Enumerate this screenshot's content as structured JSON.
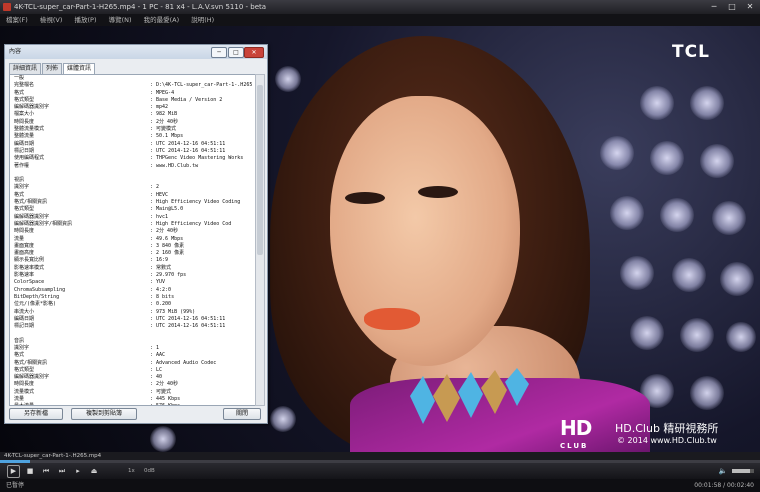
{
  "window": {
    "title": "4K-TCL-super_car-Part-1-H265.mp4 - 1 PC - 81 x4 - L.A.V.svn 5110 - beta",
    "min_label": "─",
    "max_label": "□",
    "close_label": "✕"
  },
  "menu": [
    "檔案(F)",
    "檢視(V)",
    "播放(P)",
    "導覽(N)",
    "我的最愛(A)",
    "說明(H)"
  ],
  "dialog": {
    "title": "內容",
    "min_label": "─",
    "max_label": "□",
    "close_label": "✕",
    "tabs": [
      "詳細資訊",
      "列佈",
      "媒體資訊"
    ],
    "active_tab": 2,
    "rows": [
      {
        "k": "一般",
        "v": ""
      },
      {
        "k": "完整檔名",
        "v": ": D:\\4K-TCL-super_car-Part-1-.H265"
      },
      {
        "k": "格式",
        "v": ": MPEG-4"
      },
      {
        "k": "格式類型",
        "v": ": Base Media / Version 2"
      },
      {
        "k": "編解碼器識別字",
        "v": ": mp42"
      },
      {
        "k": "檔案大小",
        "v": ": 982 MiB"
      },
      {
        "k": "時間長度",
        "v": ": 2分 40秒"
      },
      {
        "k": "整體流量模式",
        "v": ": 可變模式"
      },
      {
        "k": "整體流量",
        "v": ": 50.1 Mbps"
      },
      {
        "k": "編碼日期",
        "v": ": UTC 2014-12-16 04:51:11"
      },
      {
        "k": "標記日期",
        "v": ": UTC 2014-12-16 04:51:11"
      },
      {
        "k": "使用編碼程式",
        "v": ": THPGenc Video Mastering Works"
      },
      {
        "k": "著作權",
        "v": ": www.HD.Club.tw"
      },
      {
        "k": "",
        "v": ""
      },
      {
        "k": "視訊",
        "v": ""
      },
      {
        "k": "識別字",
        "v": ": 2"
      },
      {
        "k": "格式",
        "v": ": HEVC"
      },
      {
        "k": "格式/相關資訊",
        "v": ": High Efficiency Video Coding"
      },
      {
        "k": "格式類型",
        "v": ": Main@L5.0"
      },
      {
        "k": "編解碼器識別字",
        "v": ": hvc1"
      },
      {
        "k": "編解碼器識別字/相關資訊",
        "v": ": High Efficiency Video Cod"
      },
      {
        "k": "時間長度",
        "v": ": 2分 40秒"
      },
      {
        "k": "流量",
        "v": ": 49.6 Mbps"
      },
      {
        "k": "畫面寬度",
        "v": ": 3 840 像素"
      },
      {
        "k": "畫面高度",
        "v": ": 2 160 像素"
      },
      {
        "k": "顯示長寬比例",
        "v": ": 16:9"
      },
      {
        "k": "影格速率模式",
        "v": ": 常數式"
      },
      {
        "k": "影格速率",
        "v": ": 29.970 fps"
      },
      {
        "k": "ColorSpace",
        "v": ": YUV"
      },
      {
        "k": "ChromaSubsampling",
        "v": ": 4:2:0"
      },
      {
        "k": "BitDepth/String",
        "v": ": 8 bits"
      },
      {
        "k": "位元/(像素*影格)",
        "v": ": 0.200"
      },
      {
        "k": "串流大小",
        "v": ": 973 MiB (99%)"
      },
      {
        "k": "編碼日期",
        "v": ": UTC 2014-12-16 04:51:11"
      },
      {
        "k": "標記日期",
        "v": ": UTC 2014-12-16 04:51:11"
      },
      {
        "k": "",
        "v": ""
      },
      {
        "k": "音訊",
        "v": ""
      },
      {
        "k": "識別字",
        "v": ": 1"
      },
      {
        "k": "格式",
        "v": ": AAC"
      },
      {
        "k": "格式/相關資訊",
        "v": ": Advanced Audio Codec"
      },
      {
        "k": "格式類型",
        "v": ": LC"
      },
      {
        "k": "編解碼器識別字",
        "v": ": 40"
      },
      {
        "k": "時間長度",
        "v": ": 2分 40秒"
      },
      {
        "k": "流量模式",
        "v": ": 可變式"
      },
      {
        "k": "流量",
        "v": ": 445 Kbps"
      },
      {
        "k": "最大流量",
        "v": ": 576 Kbps"
      },
      {
        "k": "聲道數",
        "v": ": 2 聲道"
      },
      {
        "k": "聲道位置",
        "v": ": Front: L R"
      }
    ],
    "save_button": "另存新檔",
    "copy_button": "複製到剪貼簿",
    "close_button": "關閉"
  },
  "overlay": {
    "tcl_logo": "TCL",
    "hd_logo": "HD",
    "hd_club": "CLUB",
    "brand_line": "HD.Club 精研視務所",
    "copyright_line": "© 2014  www.HD.Club.tw"
  },
  "player": {
    "file_label": "4K-TCL-super_car-Part-1-.H265.mp4",
    "seek_progress": 0.04,
    "speed_text": "1x",
    "audio_text": "0dB",
    "volume_level": 0.8,
    "status": "已暫停",
    "time": "00:01:58 / 00:02:40"
  }
}
